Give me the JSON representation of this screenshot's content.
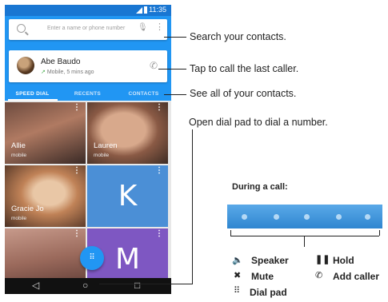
{
  "status_bar": {
    "time": "11:35"
  },
  "search": {
    "placeholder": "Enter a name or phone number",
    "search_icon": "search-icon",
    "mic_icon": "mic-icon",
    "more_icon": "more-vert-icon"
  },
  "last_caller": {
    "name": "Abe Baudo",
    "detail": "Mobile, 5 mins ago",
    "call_icon": "phone-icon"
  },
  "tabs": [
    {
      "label": "SPEED DIAL",
      "selected": true
    },
    {
      "label": "RECENTS",
      "selected": false
    },
    {
      "label": "CONTACTS",
      "selected": false
    }
  ],
  "speed_dial": [
    {
      "name": "Allie",
      "type": "mobile"
    },
    {
      "name": "Lauren",
      "type": "mobile"
    },
    {
      "name": "Gracie Jo",
      "type": "mobile"
    },
    {
      "letter": "K"
    },
    {
      "name": "",
      "type": ""
    },
    {
      "letter": "M"
    }
  ],
  "callouts": {
    "search": "Search your contacts.",
    "last_caller": "Tap to call the last caller.",
    "contacts": "See all of your contacts.",
    "dial_pad": "Open dial pad to dial a number."
  },
  "during_call": {
    "title": "During a call:",
    "legend": {
      "speaker": "Speaker",
      "hold": "Hold",
      "mute": "Mute",
      "add_caller": "Add caller",
      "dial_pad": "Dial pad"
    }
  },
  "colors": {
    "app_blue": "#2196f3",
    "status_blue": "#1976d2",
    "tile_k": "#4b8fd6",
    "tile_m": "#7e57c2"
  }
}
